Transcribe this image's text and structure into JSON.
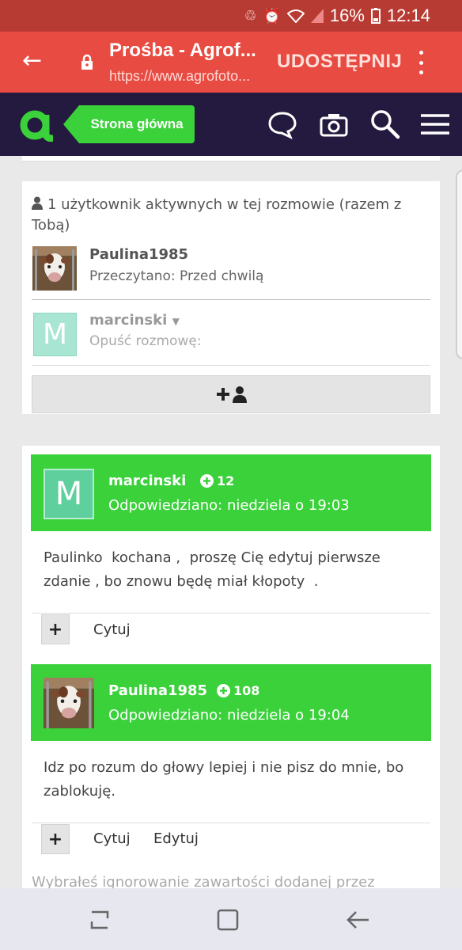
{
  "status_bar": {
    "battery": "16%",
    "time": "12:14"
  },
  "browser": {
    "title": "Prośba - Agrof...",
    "url": "https://www.agrofoto...",
    "share_label": "UDOSTĘPNIJ"
  },
  "site_header": {
    "home_label": "Strona główna"
  },
  "conversation": {
    "active_users_text": "1 użytkownik aktywnych w tej rozmowie (razem z Tobą)",
    "participants": [
      {
        "name": "Paulina1985",
        "status": "Przeczytano: Przed chwilą",
        "avatar": "cow-photo"
      },
      {
        "name": "marcinski",
        "status": "Opuść rozmowę:",
        "avatar_letter": "M"
      }
    ]
  },
  "posts": [
    {
      "author": "marcinski",
      "avatar_letter": "M",
      "reputation": "12",
      "date": "Odpowiedziano: niedziela o 19:03",
      "body": "Paulinko  kochana ,  proszę Cię edytuj pierwsze  zdanie , bo znowu będę miał kłopoty  .",
      "actions": [
        "Cytuj"
      ]
    },
    {
      "author": "Paulina1985",
      "avatar": "cow-photo",
      "reputation": "108",
      "date": "Odpowiedziano: niedziela o 19:04",
      "body": "Idz po rozum do głowy lepiej i nie pisz do mnie, bo zablokuję.",
      "actions": [
        "Cytuj",
        "Edytuj"
      ]
    }
  ],
  "ignore_note": "Wybrałeś ignorowanie zawartości dodanej przez",
  "colors": {
    "accent_green": "#3ad13a",
    "header_navy": "#24193e",
    "browser_red": "#e84b41",
    "status_red": "#b83b33"
  }
}
